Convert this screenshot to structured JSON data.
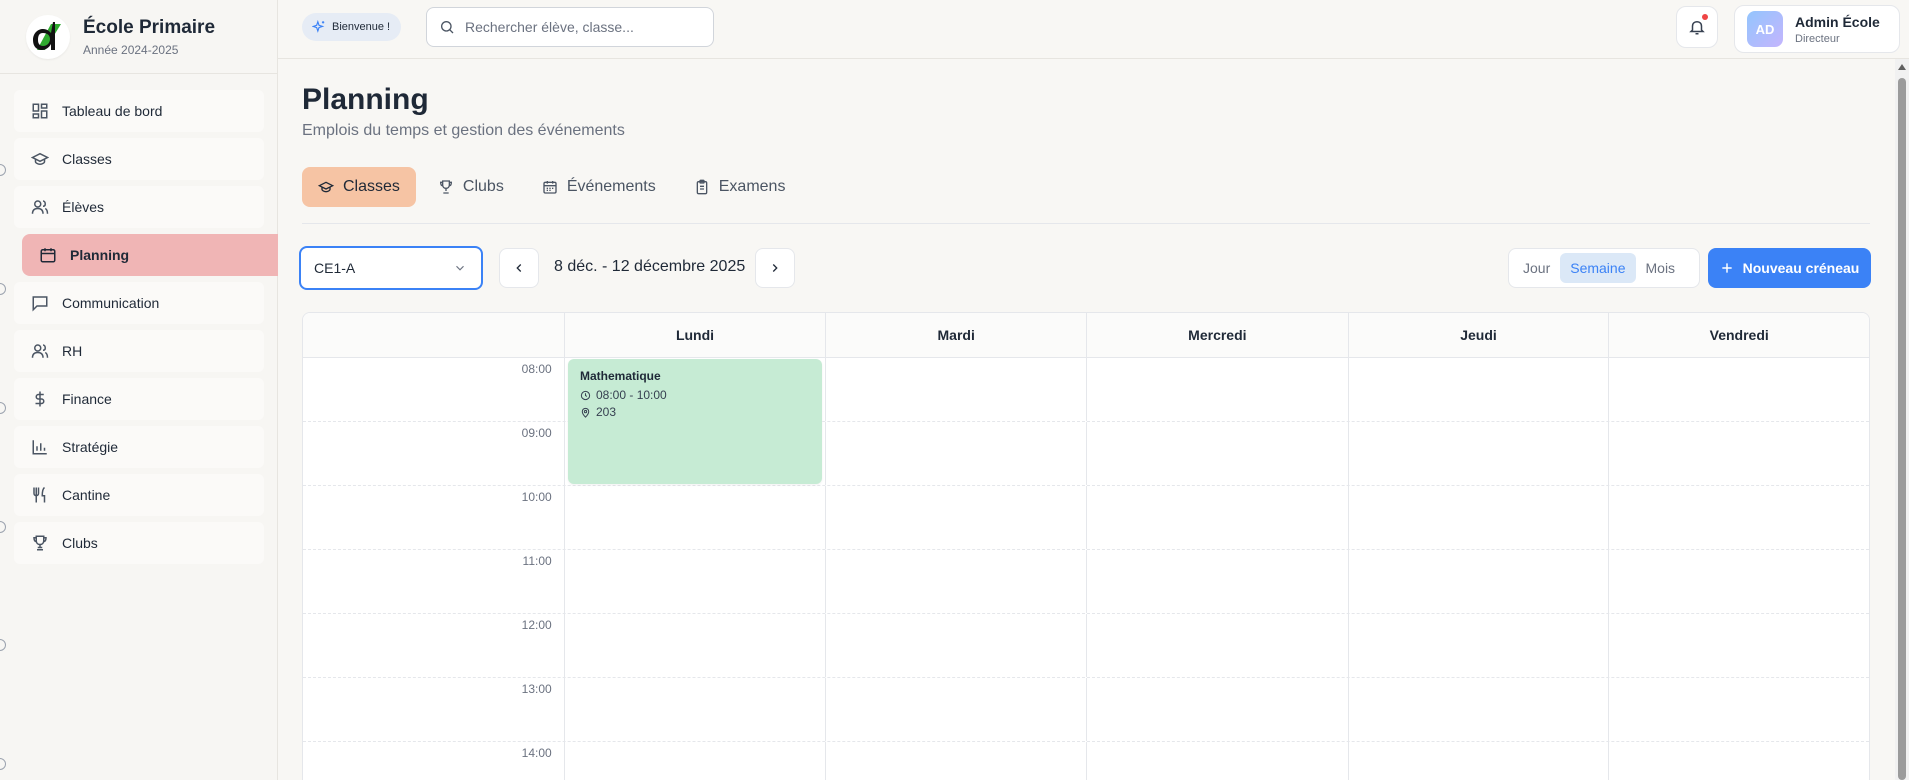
{
  "brand": {
    "title": "École Primaire",
    "subtitle": "Année 2024-2025"
  },
  "sidebar": {
    "items": [
      {
        "label": "Tableau de bord",
        "icon": "dashboard-icon"
      },
      {
        "label": "Classes",
        "icon": "graduation-cap-icon"
      },
      {
        "label": "Élèves",
        "icon": "users-icon"
      },
      {
        "label": "Planning",
        "icon": "calendar-icon",
        "active": true
      },
      {
        "label": "Communication",
        "icon": "message-icon"
      },
      {
        "label": "RH",
        "icon": "users-icon"
      },
      {
        "label": "Finance",
        "icon": "dollar-icon"
      },
      {
        "label": "Stratégie",
        "icon": "bar-chart-icon"
      },
      {
        "label": "Cantine",
        "icon": "utensils-icon"
      },
      {
        "label": "Clubs",
        "icon": "trophy-icon"
      }
    ]
  },
  "header": {
    "welcome": "Bienvenue !",
    "search_placeholder": "Rechercher élève, classe...",
    "user_initials": "AD",
    "user_name": "Admin École",
    "user_role": "Directeur"
  },
  "page": {
    "title": "Planning",
    "subtitle": "Emplois du temps et gestion des événements"
  },
  "tabs": [
    {
      "label": "Classes",
      "active": true
    },
    {
      "label": "Clubs"
    },
    {
      "label": "Événements"
    },
    {
      "label": "Examens"
    }
  ],
  "controls": {
    "class_selected": "CE1-A",
    "date_range": "8 déc. - 12 décembre 2025",
    "views": [
      "Jour",
      "Semaine",
      "Mois"
    ],
    "active_view": "Semaine",
    "new_slot": "Nouveau créneau"
  },
  "calendar": {
    "days": [
      "Lundi",
      "Mardi",
      "Mercredi",
      "Jeudi",
      "Vendredi"
    ],
    "hours": [
      "08:00",
      "09:00",
      "10:00",
      "11:00",
      "12:00",
      "13:00",
      "14:00"
    ],
    "events": [
      {
        "title": "Mathematique",
        "time": "08:00 - 10:00",
        "room": "203",
        "day": "Lundi",
        "color": "#c6ebd4"
      }
    ]
  },
  "colors": {
    "accent": "#3b82f6",
    "active_nav": "#f0b5b5",
    "active_tab": "#f6c4a4",
    "event_green": "#c6ebd4"
  }
}
